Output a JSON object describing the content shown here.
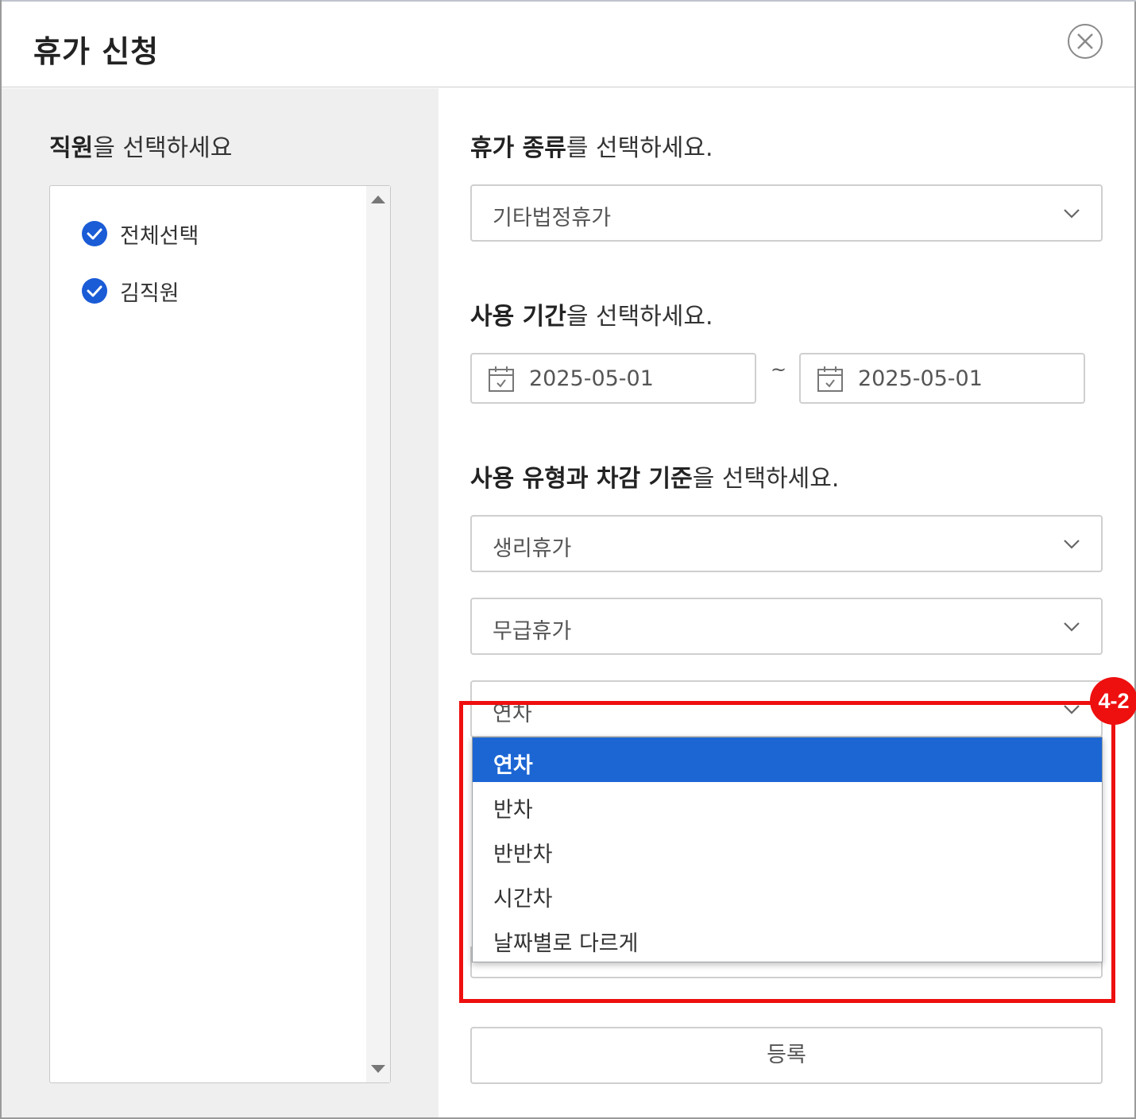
{
  "dialog": {
    "title": "휴가 신청"
  },
  "employees": {
    "heading_bold": "직원",
    "heading_rest": "을 선택하세요",
    "items": [
      {
        "label": "전체선택",
        "checked": true
      },
      {
        "label": "김직원",
        "checked": true
      }
    ]
  },
  "leave_type": {
    "heading_bold": "휴가 종류",
    "heading_rest": "를 선택하세요.",
    "value": "기타법정휴가"
  },
  "period": {
    "heading_bold": "사용 기간",
    "heading_rest": "을 선택하세요.",
    "start_date": "2025-05-01",
    "separator": "~",
    "end_date": "2025-05-01"
  },
  "usage": {
    "heading_bold": "사용 유형과 차감 기준",
    "heading_rest": "을 선택하세요.",
    "select_1": "생리휴가",
    "select_2": "무급휴가",
    "select_3": "연차",
    "options": [
      "연차",
      "반차",
      "반반차",
      "시간차",
      "날짜별로 다르게"
    ],
    "selected_option": "연차"
  },
  "submit_label": "등록",
  "annotation": {
    "label": "4-2",
    "color": "#ee0f0f"
  },
  "colors": {
    "accent": "#1c66d4",
    "check": "#1a5bd6"
  }
}
